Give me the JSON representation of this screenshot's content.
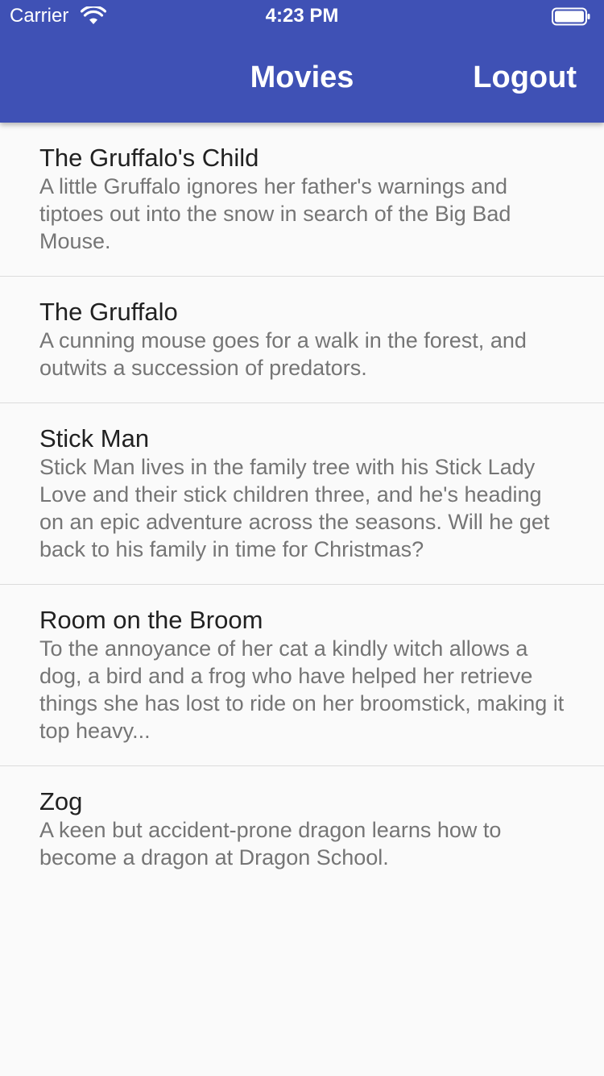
{
  "status_bar": {
    "carrier": "Carrier",
    "time": "4:23 PM",
    "wifi_icon": "wifi-icon",
    "battery_icon": "battery-icon"
  },
  "nav": {
    "title": "Movies",
    "logout_label": "Logout"
  },
  "colors": {
    "app_bar": "#3f51b5",
    "background": "#fafafa",
    "title_text": "#212121",
    "subtitle_text": "#757575"
  },
  "movies": [
    {
      "title": "The Gruffalo's Child",
      "description": "A little Gruffalo ignores her father's warnings and tiptoes out into the snow in search of the Big Bad Mouse."
    },
    {
      "title": "The Gruffalo",
      "description": "A cunning mouse goes for a walk in the forest, and outwits a succession of predators."
    },
    {
      "title": "Stick Man",
      "description": "Stick Man lives in the family tree with his Stick Lady Love and their stick children three, and he's heading on an epic adventure across the seasons. Will he get back to his family in time for Christmas?"
    },
    {
      "title": "Room on the Broom",
      "description": "To the annoyance of her cat a kindly witch allows a dog, a bird and a frog who have helped her retrieve things she has lost to ride on her broomstick, making it top heavy..."
    },
    {
      "title": "Zog",
      "description": "A keen but accident-prone dragon learns how to become a dragon at Dragon School."
    }
  ]
}
